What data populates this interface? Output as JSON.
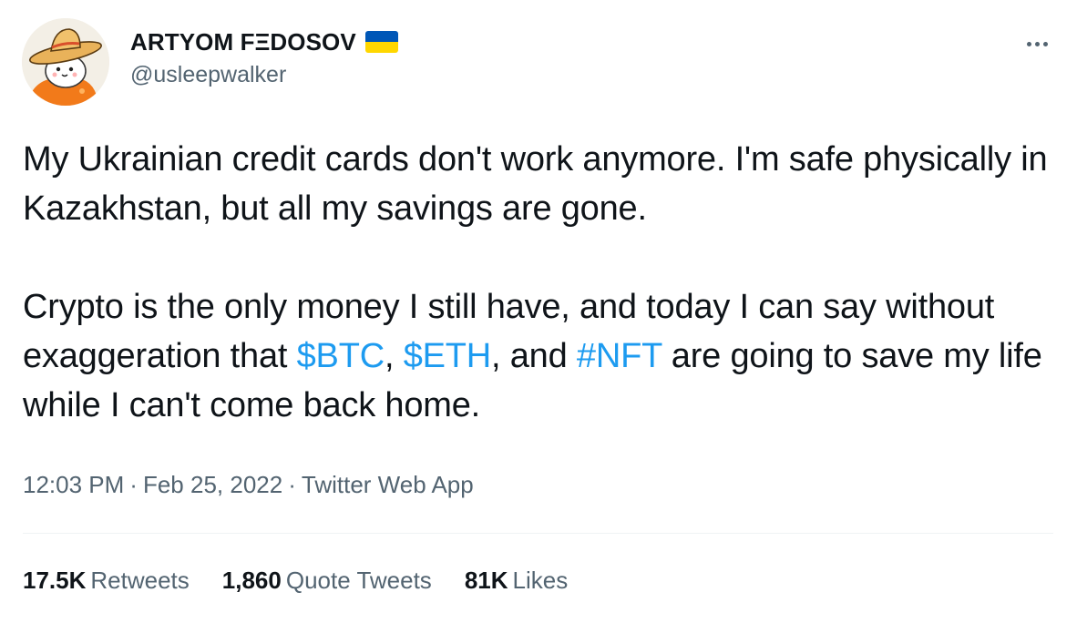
{
  "author": {
    "display_name": "ARTYOM FΞDOSOV",
    "handle": "@usleepwalker",
    "flag": "ukraine-flag"
  },
  "tweet": {
    "p1": "My Ukrainian credit cards don't work anymore. I'm safe physically in Kazakhstan, but all my savings are gone.",
    "p2_a": "Crypto is the only money I still have, and today I can say without exaggeration that ",
    "cashtag_btc": "$BTC",
    "sep_1": ", ",
    "cashtag_eth": "$ETH",
    "sep_2": ", and ",
    "hashtag_nft": "#NFT",
    "p2_b": " are going to save my life while I can't come back home."
  },
  "meta": {
    "time": "12:03 PM",
    "dot": "·",
    "date": "Feb 25, 2022",
    "source": "Twitter Web App"
  },
  "stats": {
    "retweets_count": "17.5K",
    "retweets_label": "Retweets",
    "quotes_count": "1,860",
    "quotes_label": "Quote Tweets",
    "likes_count": "81K",
    "likes_label": "Likes"
  },
  "colors": {
    "link": "#1d9bf0",
    "text": "#0f1419",
    "secondary": "#536471",
    "flag_blue": "#0057b7",
    "flag_yellow": "#ffd700"
  }
}
